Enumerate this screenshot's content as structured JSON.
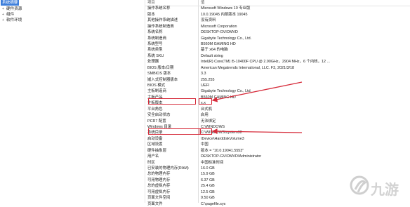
{
  "tree": {
    "root": "系统摘要",
    "children": [
      {
        "expander": "+",
        "label": "硬件资源"
      },
      {
        "expander": "+",
        "label": "组件"
      },
      {
        "expander": "+",
        "label": "软件环境"
      }
    ]
  },
  "grid": {
    "header": {
      "k": "项目",
      "v": "值"
    },
    "rows": [
      {
        "k": "操作系统名称",
        "v": "Microsoft Windows 10 专业版"
      },
      {
        "k": "版本",
        "v": "10.0.19045 内部版本 19045"
      },
      {
        "k": "其他操作系统描述",
        "v": "没有资料"
      },
      {
        "k": "操作系统制造商",
        "v": "Microsoft Corporation"
      },
      {
        "k": "系统名称",
        "v": "DESKTOP-GVIOMVD"
      },
      {
        "k": "系统制造商",
        "v": "Gigabyte Technology Co., Ltd."
      },
      {
        "k": "系统型号",
        "v": "B560M GAMING HD"
      },
      {
        "k": "系统类型",
        "v": "基于 x64 的电脑"
      },
      {
        "k": "系统 SKU",
        "v": "Default string"
      },
      {
        "k": "处理器",
        "v": "Intel(R) Core(TM) i5-10400F CPU @ 2.90GHz，2904 MHz，6 个内核，12 ..."
      },
      {
        "k": "BIOS 版本/日期",
        "v": "American Megatrends International, LLC. F3, 2021/3/18"
      },
      {
        "k": "SMBIOS 版本",
        "v": "3.3"
      },
      {
        "k": "嵌入式控制器版本",
        "v": "255.255"
      },
      {
        "k": "BIOS 模式",
        "v": "UEFI"
      },
      {
        "k": "主板制造商",
        "v": "Gigabyte Technology Co., Ltd."
      },
      {
        "k": "主板产品",
        "v": "B560M GAMING HD"
      },
      {
        "k": "主板版本",
        "v": "x.x"
      },
      {
        "k": "平台角色",
        "v": "台式机"
      },
      {
        "k": "安全启动状态",
        "v": "启用"
      },
      {
        "k": "PCR7 配置",
        "v": "无法绑定"
      },
      {
        "k": "Windows 目录",
        "v": "C:\\WINDOWS"
      },
      {
        "k": "系统目录",
        "v": "C:\\WINDOWS\\system32"
      },
      {
        "k": "启动设备",
        "v": "\\Device\\HarddiskVolume3"
      },
      {
        "k": "区域设置",
        "v": "中国"
      },
      {
        "k": "硬件抽象层",
        "v": "版本 = \"10.0.19041.5553\""
      },
      {
        "k": "用户名",
        "v": "DESKTOP-GVIOMVD\\Administrator"
      },
      {
        "k": "时区",
        "v": "中国标准时间"
      },
      {
        "k": "已安装的物理内存(RAM)",
        "v": "16.0 GB"
      },
      {
        "k": "总的物理内存",
        "v": "15.9 GB"
      },
      {
        "k": "可用物理内存",
        "v": "6.37 GB"
      },
      {
        "k": "总的虚拟内存",
        "v": "25.4 GB"
      },
      {
        "k": "可用虚拟内存",
        "v": "12.5 GB"
      },
      {
        "k": "页面文件空间",
        "v": "9.50 GB"
      },
      {
        "k": "页面文件",
        "v": "C:\\pagefile.sys"
      }
    ]
  },
  "annotations": {
    "color": "#d62b3a"
  },
  "watermark": {
    "icon": "jiuyou-logo-icon",
    "text": "九游"
  }
}
